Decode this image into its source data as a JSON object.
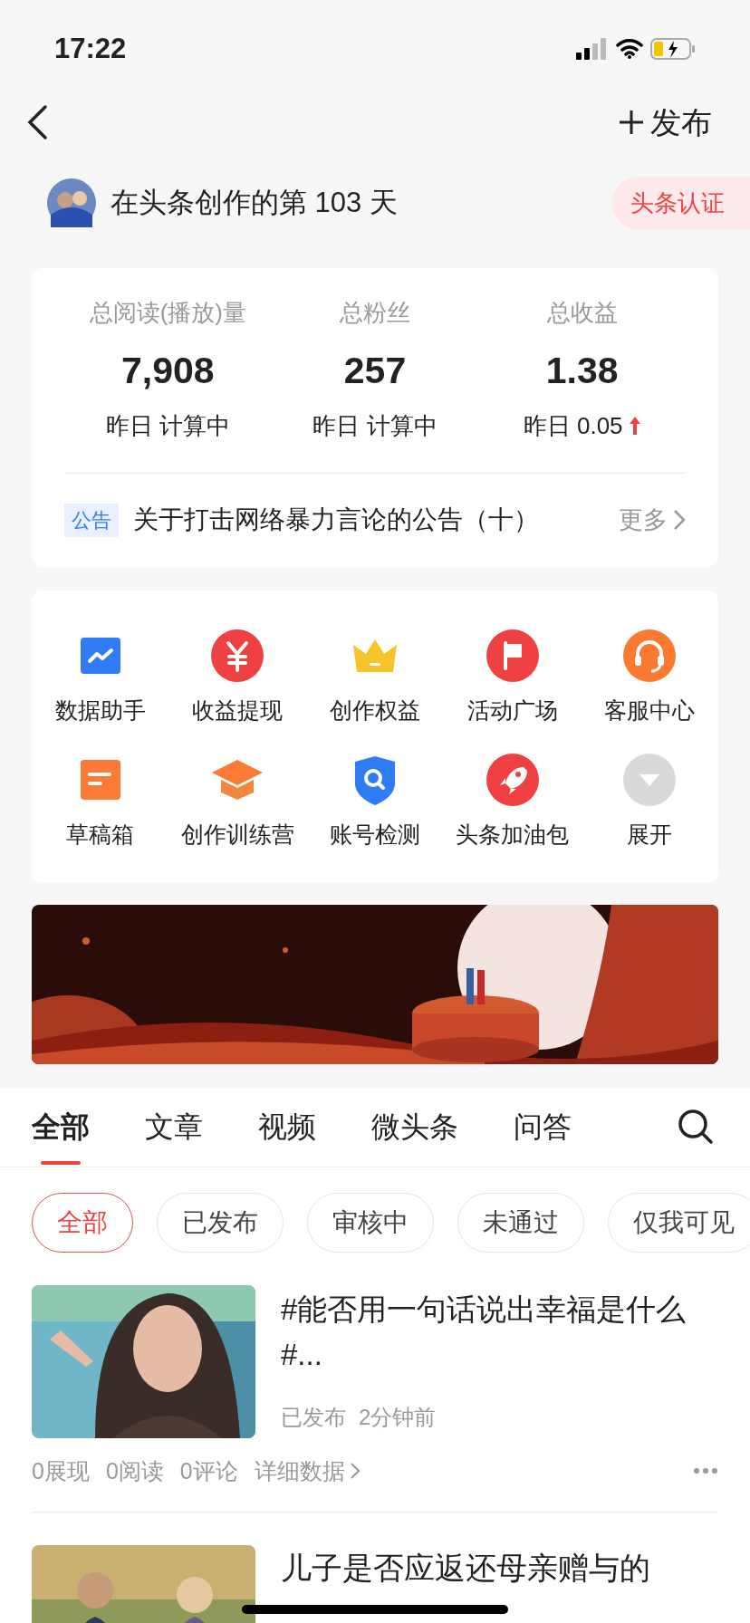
{
  "status_bar": {
    "time": "17:22"
  },
  "nav": {
    "publish": "发布"
  },
  "profile": {
    "days_text": "在头条创作的第 103 天",
    "badge": "头条认证"
  },
  "stats": [
    {
      "label": "总阅读(播放)量",
      "value": "7,908",
      "yesterday": "昨日 计算中",
      "rising": false
    },
    {
      "label": "总粉丝",
      "value": "257",
      "yesterday": "昨日 计算中",
      "rising": false
    },
    {
      "label": "总收益",
      "value": "1.38",
      "yesterday": "昨日 0.05",
      "rising": true
    }
  ],
  "notice": {
    "tag": "公告",
    "text": "关于打击网络暴力言论的公告（十）",
    "more": "更多"
  },
  "tools": [
    {
      "label": "数据助手"
    },
    {
      "label": "收益提现"
    },
    {
      "label": "创作权益"
    },
    {
      "label": "活动广场"
    },
    {
      "label": "客服中心"
    },
    {
      "label": "草稿箱"
    },
    {
      "label": "创作训练营"
    },
    {
      "label": "账号检测"
    },
    {
      "label": "头条加油包"
    },
    {
      "label": "展开"
    }
  ],
  "tabs": [
    {
      "label": "全部",
      "selected": true
    },
    {
      "label": "文章",
      "selected": false
    },
    {
      "label": "视频",
      "selected": false
    },
    {
      "label": "微头条",
      "selected": false
    },
    {
      "label": "问答",
      "selected": false
    }
  ],
  "filters": [
    {
      "label": "全部",
      "selected": true
    },
    {
      "label": "已发布",
      "selected": false
    },
    {
      "label": "审核中",
      "selected": false
    },
    {
      "label": "未通过",
      "selected": false
    },
    {
      "label": "仅我可见",
      "selected": false
    }
  ],
  "articles": [
    {
      "title": "#能否用一句话说出幸福是什么#...",
      "status": "已发布",
      "time": "2分钟前",
      "impressions": "0展现",
      "reads": "0阅读",
      "comments": "0评论",
      "details": "详细数据"
    },
    {
      "title": "儿子是否应返还母亲赠与的"
    }
  ]
}
